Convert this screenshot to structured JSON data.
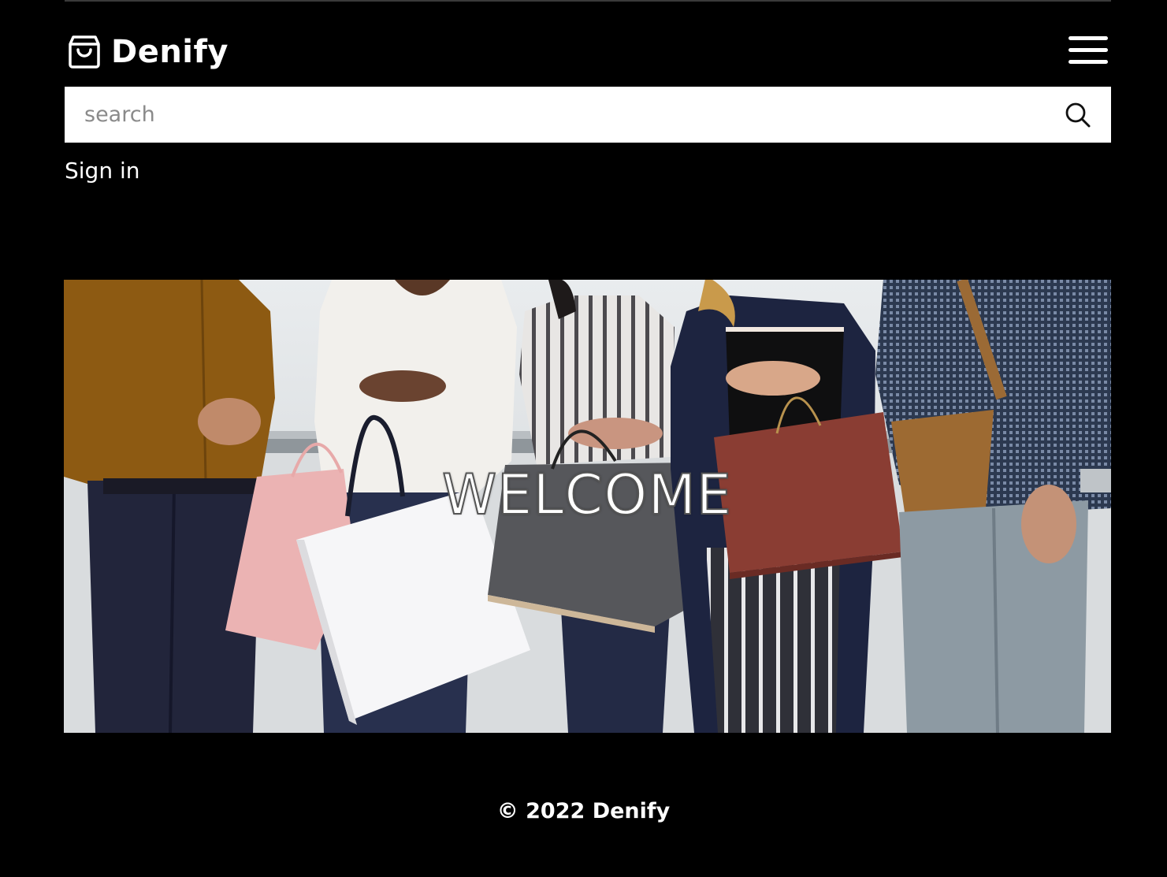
{
  "brand": {
    "name": "Denify",
    "icon": "shopping-bag-icon"
  },
  "menu": {
    "icon": "hamburger-menu-icon"
  },
  "search": {
    "placeholder": "search",
    "value": "",
    "icon": "search-icon"
  },
  "auth": {
    "signin_label": "Sign in"
  },
  "hero": {
    "title": "WELCOME"
  },
  "footer": {
    "copyright": "© 2022 Denify"
  },
  "colors": {
    "background": "#000000",
    "text": "#ffffff",
    "search_bg": "#ffffff",
    "placeholder": "#8a8a8a"
  }
}
